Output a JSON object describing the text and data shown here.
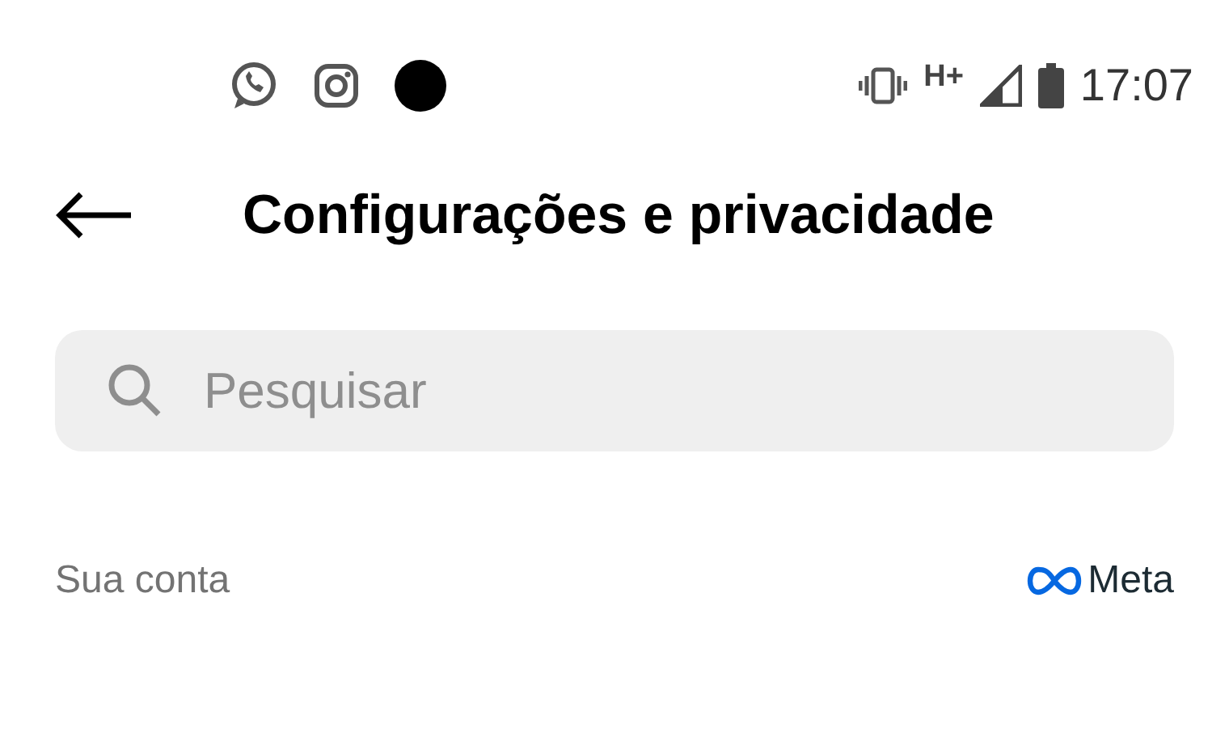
{
  "status_bar": {
    "network": "H+",
    "time": "17:07"
  },
  "header": {
    "title": "Configurações e privacidade"
  },
  "search": {
    "placeholder": "Pesquisar"
  },
  "section": {
    "title": "Sua conta",
    "brand": "Meta"
  }
}
